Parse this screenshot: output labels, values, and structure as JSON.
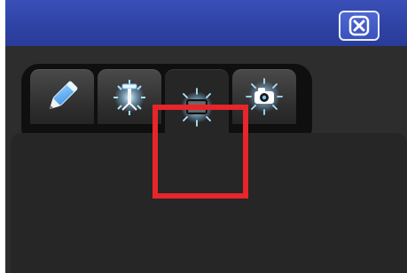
{
  "titlebar": {
    "close_icon": "close-icon"
  },
  "tabs": [
    {
      "icon": "pencil-icon",
      "active": false
    },
    {
      "icon": "light-stand-icon",
      "active": false
    },
    {
      "icon": "screen-icon",
      "active": true
    },
    {
      "icon": "camera-icon",
      "active": false
    }
  ],
  "colors": {
    "titlebar": "#2f43a6",
    "window_background": "#2d2d2d",
    "tab_strip": "#0f0f0f",
    "active_tab": "#262626",
    "highlight": "#e8252a",
    "icon_glow": "#9fd7ff"
  }
}
